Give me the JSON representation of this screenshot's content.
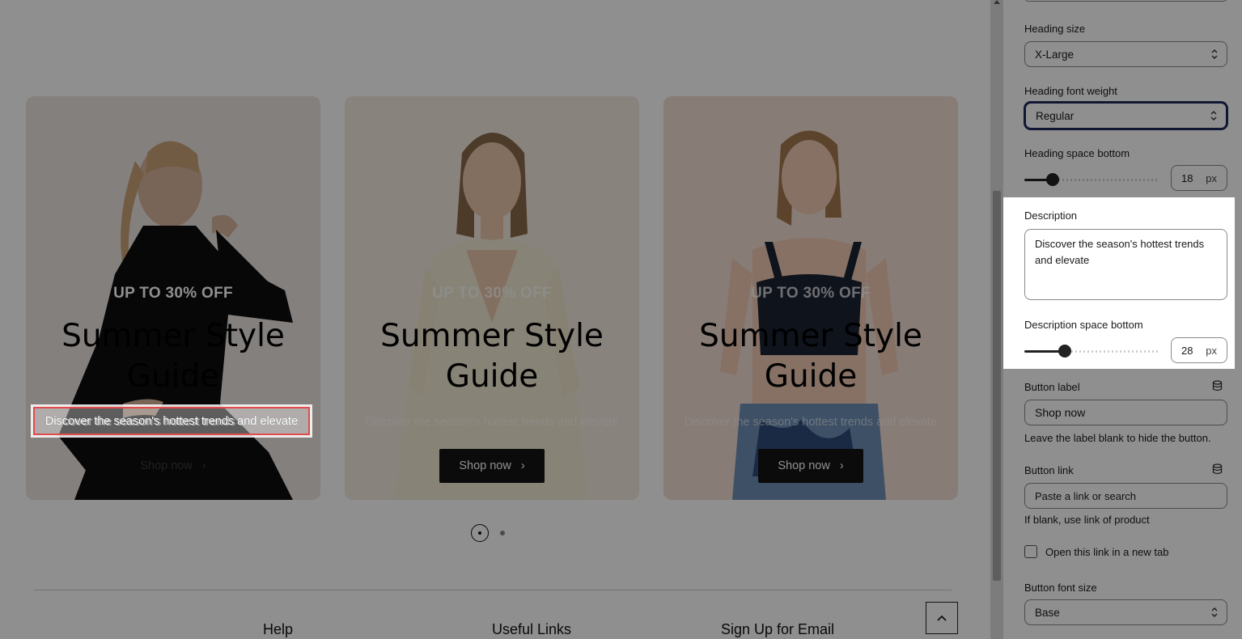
{
  "preview": {
    "cards": [
      {
        "eyebrow": "UP TO 30% OFF",
        "heading": "Summer Style Guide",
        "description": "Discover the season's hottest trends and elevate",
        "button": "Shop now"
      },
      {
        "eyebrow": "UP TO 30% OFF",
        "heading": "Summer Style Guide",
        "description": "Discover the season's hottest trends and elevate",
        "button": "Shop now"
      },
      {
        "eyebrow": "UP TO 30% OFF",
        "heading": "Summer Style Guide",
        "description": "Discover the season's hottest trends and elevate",
        "button": "Shop now"
      }
    ],
    "highlight_text": "Discover the season's hottest trends and elevate",
    "footer": {
      "col_help": "Help",
      "col_links": "Useful Links",
      "col_email": "Sign Up for Email"
    }
  },
  "panel": {
    "heading_size": {
      "label": "Heading size",
      "value": "X-Large"
    },
    "heading_weight": {
      "label": "Heading font weight",
      "value": "Regular"
    },
    "heading_space": {
      "label": "Heading space bottom",
      "value": "18",
      "unit": "px"
    },
    "description": {
      "label": "Description",
      "value": "Discover the season's hottest trends and elevate"
    },
    "description_space": {
      "label": "Description space bottom",
      "value": "28",
      "unit": "px"
    },
    "button_label": {
      "label": "Button label",
      "value": "Shop now",
      "help": "Leave the label blank to hide the button."
    },
    "button_link": {
      "label": "Button link",
      "placeholder": "Paste a link or search",
      "help": "If blank, use link of product"
    },
    "new_tab": {
      "label": "Open this link in a new tab",
      "checked": false
    },
    "button_font_size": {
      "label": "Button font size",
      "value": "Base"
    }
  },
  "colors": {
    "highlight_border": "#e24b4b",
    "focus_ring": "#1f2a5a",
    "dim_overlay": "rgba(0,0,0,0.44)"
  }
}
